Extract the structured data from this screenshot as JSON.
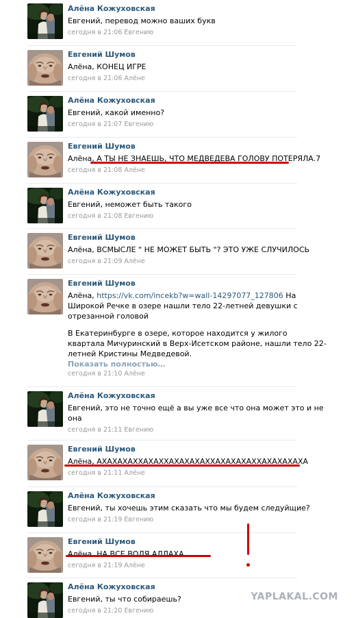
{
  "authors": {
    "alena": "Алёна Кожуховская",
    "evgeniy": "Евгений Шумов"
  },
  "posts": [
    {
      "author": "Алёна Кожуховская",
      "text": "Евгений, перевод можно ваших букв",
      "meta": "сегодня в 21:06 Евгению"
    },
    {
      "author": "Евгений Шумов",
      "text": "Алёна, КОНЕЦ ИГРЕ",
      "meta": "сегодня в 21:06 Алёне"
    },
    {
      "author": "Алёна Кожуховская",
      "text": "Евгений, какой именно?",
      "meta": "сегодня в 21:07 Евгению"
    },
    {
      "author": "Евгений Шумов",
      "text": "Алёна, А ТЫ НЕ ЗНАЕШЬ, ЧТО МЕДВЕДЕВА ГОЛОВУ ПОТЕРЯЛА.7",
      "meta": "сегодня в 21:08 Алёне"
    },
    {
      "author": "Алёна Кожуховская",
      "text": "Евгений, неможет быть такого",
      "meta": "сегодня в 21:08 Евгению"
    },
    {
      "author": "Евгений Шумов",
      "text": "Алёна, ВСМЫСЛЕ \" НЕ МОЖЕТ БЫТЬ \"? ЭТО УЖЕ СЛУЧИЛОСЬ",
      "meta": "сегодня в 21:09 Алёне"
    },
    {
      "author": "Евгений Шумов",
      "text_prefix": "Алёна, ",
      "link": "https://vk.com/incekb?w=wall-14297077_127806",
      "text_suffix": " На",
      "text_line2": "Широкой Речке в озере нашли тело 22-летней девушки с",
      "text_line3": "отрезанной головой",
      "extra_line1": "В Екатеринбурге в озере, которое находится у жилого",
      "extra_line2": "квартала Мичуринский в Верх-Исетском районе, нашли тело 22-",
      "extra_line3": "летней Кристины Медведевой.",
      "more": "Показать полностью…",
      "meta": "сегодня в 21:10 Алёне"
    },
    {
      "author": "Алёна Кожуховская",
      "text_line1": "Евгений, это не точно ещё а вы уже все что она может это и не",
      "text_line2": "она",
      "meta": "сегодня в 21:11 Евгению"
    },
    {
      "author": "Евгений Шумов",
      "text": "Алёна, АХАХАХАХХАХАХХАХАХАХАХХАХАХАХАХХАХАХАХАХА",
      "meta": "сегодня в 21:11 Алёне"
    },
    {
      "author": "Алёна Кожуховская",
      "text": "Евгений, ты хочешь этим сказать что мы будем следуйщие?",
      "meta": "сегодня в 21:19 Евгению"
    },
    {
      "author": "Евгений Шумов",
      "text": "Алёна, НА ВСЕ ВОЛЯ АЛЛАХА",
      "meta": "сегодня в 21:19 Алёне"
    },
    {
      "author": "Алёна Кожуховская",
      "text": "Евгений, ты что собираешь?",
      "meta": "сегодня в 21:20 Евгению"
    }
  ],
  "watermark": "YAPLAKAL.COM",
  "colors": {
    "author_link": "#2b587a",
    "meta": "#999999",
    "annotation_red": "#cc0000",
    "divider": "#e7eaed"
  }
}
